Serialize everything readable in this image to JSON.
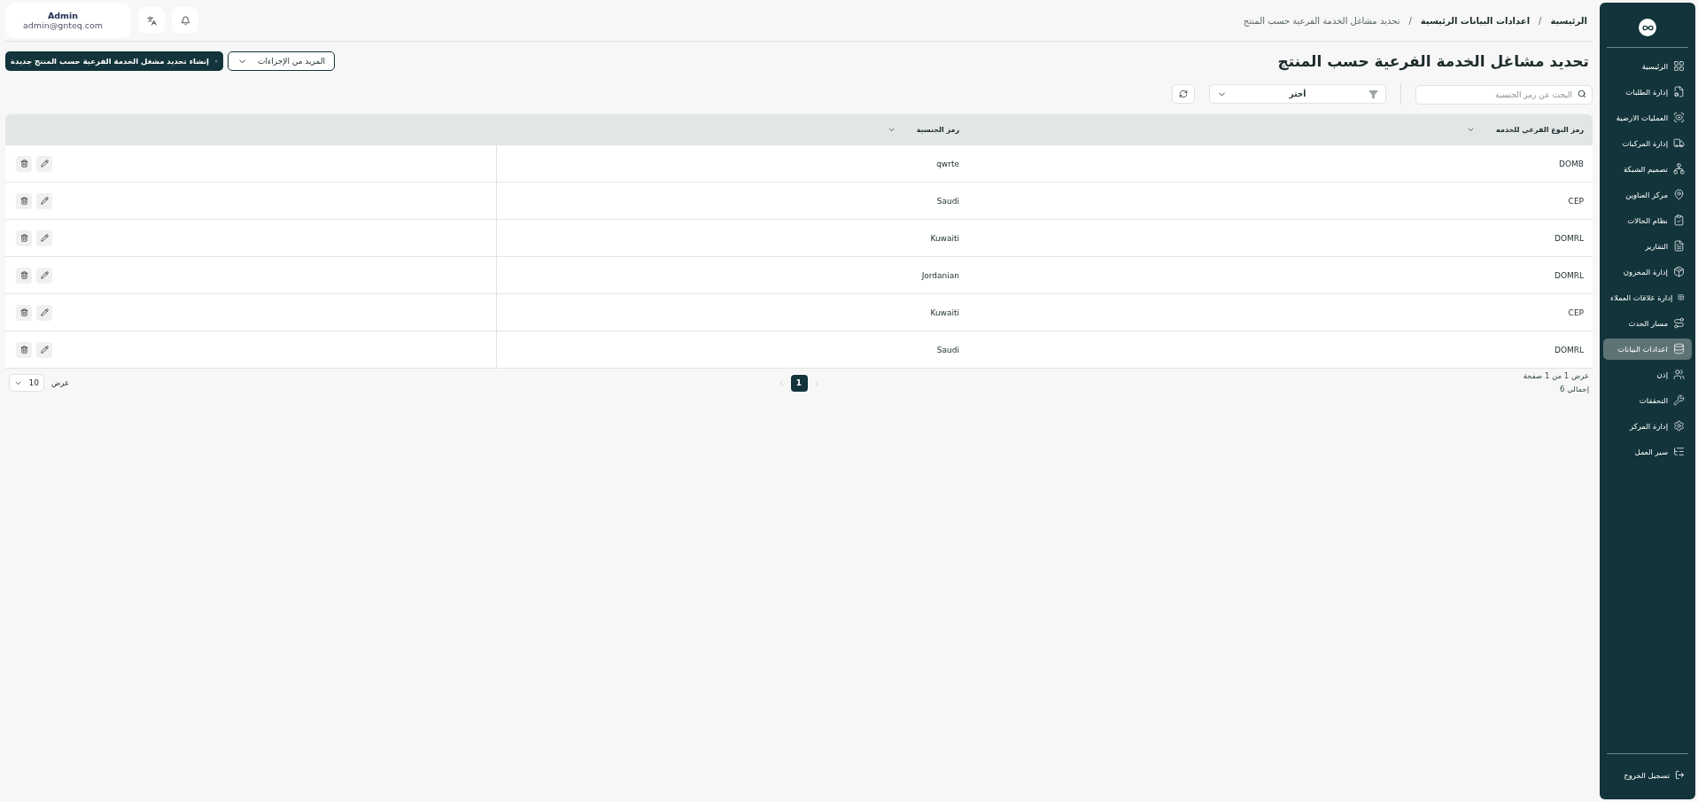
{
  "header": {
    "breadcrumb_separator": "/",
    "breadcrumbs": [
      {
        "label": "الرئيسية"
      },
      {
        "label": "اعدادات البيانات الرئيسية"
      },
      {
        "label": "تحديد مشاغل الخدمة الفرعية حسب المنتج"
      }
    ],
    "user": {
      "name": "Admin",
      "email": "admin@gnteq.com"
    }
  },
  "page": {
    "title": "تحديد مشاغل الخدمة الفرعية حسب المنتج",
    "more_actions": "المزيد من الإجراءات",
    "create": "إنشاء تحديد مشغل الخدمة الفرعية حسب المنتج جديدة"
  },
  "filters": {
    "search": {
      "placeholder": "البحث عن رمز الجنسية"
    },
    "select": {
      "value": "أختر"
    }
  },
  "table": {
    "columns": [
      {
        "label": "رمز النوع الفرعي للخدمه"
      },
      {
        "label": "رمز الجنسية"
      }
    ],
    "rows": [
      {
        "code": "DOMB",
        "nationality": "qwrte"
      },
      {
        "code": "CEP",
        "nationality": "Saudi"
      },
      {
        "code": "DOMRL",
        "nationality": "Kuwaiti"
      },
      {
        "code": "DOMRL",
        "nationality": "Jordanian"
      },
      {
        "code": "CEP",
        "nationality": "Kuwaiti"
      },
      {
        "code": "DOMRL",
        "nationality": "Saudi"
      }
    ]
  },
  "pagination": {
    "summary": "عرض 1 من 1 صفحة",
    "total": "إجمالي 6",
    "pages": [
      {
        "label": "1",
        "selected": true
      }
    ],
    "page_size": {
      "label": "عرض",
      "value": "10"
    }
  },
  "sidebar": {
    "items": [
      {
        "label": "الرئيسية",
        "selected": false
      },
      {
        "label": "إدارة الطلبات",
        "selected": false
      },
      {
        "label": "العمليات الارضية",
        "selected": false
      },
      {
        "label": "إدارة المركبات",
        "selected": false
      },
      {
        "label": "تصميم الشبكة",
        "selected": false
      },
      {
        "label": "مركز العناوين",
        "selected": false
      },
      {
        "label": "نظام الحالات",
        "selected": false
      },
      {
        "label": "التقارير",
        "selected": false
      },
      {
        "label": "إدارة المخزون",
        "selected": false
      },
      {
        "label": "إدارة علاقات العملاء",
        "selected": false
      },
      {
        "label": "مسار الحدث",
        "selected": false
      },
      {
        "label": "اعدادات البيانات",
        "selected": true
      },
      {
        "label": "إذن",
        "selected": false
      },
      {
        "label": "التحققات",
        "selected": false
      },
      {
        "label": "إدارة المركز",
        "selected": false
      },
      {
        "label": "سير العمل",
        "selected": false
      }
    ],
    "logout": "تسجيل الخروج"
  }
}
